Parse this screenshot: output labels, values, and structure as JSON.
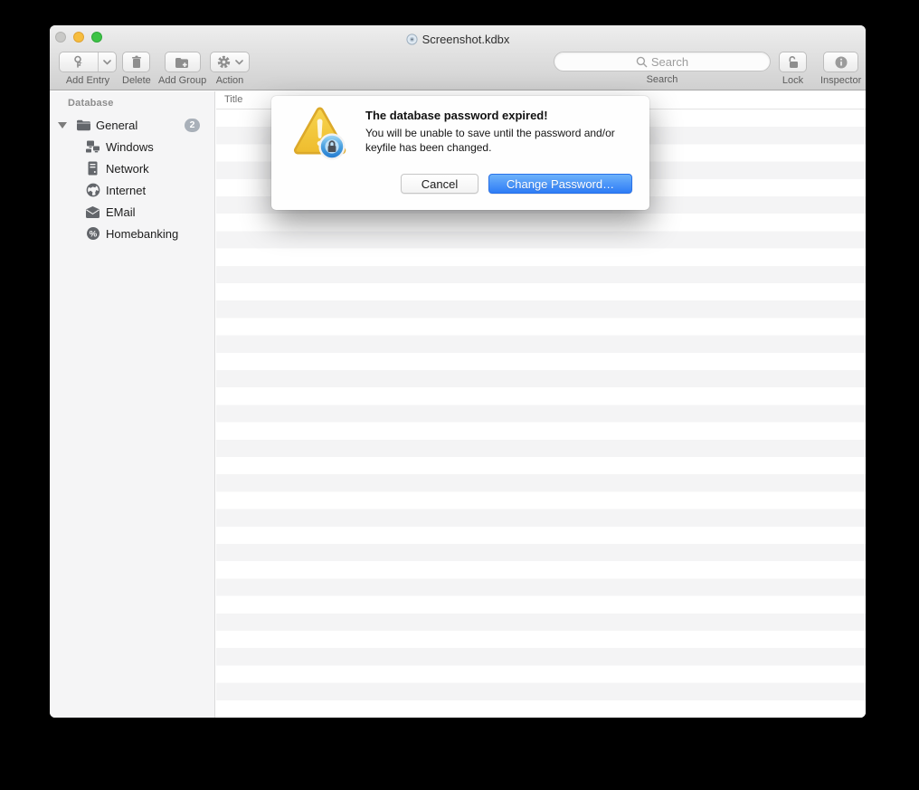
{
  "window": {
    "title": "Screenshot.kdbx"
  },
  "toolbar": {
    "add_entry_label": "Add Entry",
    "delete_label": "Delete",
    "add_group_label": "Add Group",
    "action_label": "Action",
    "search_placeholder": "Search",
    "search_label": "Search",
    "lock_label": "Lock",
    "inspector_label": "Inspector"
  },
  "sidebar": {
    "header": "Database",
    "items": [
      {
        "label": "General",
        "badge": "2",
        "icon": "folder-icon",
        "expanded": true
      },
      {
        "label": "Windows",
        "icon": "windows-network-icon"
      },
      {
        "label": "Network",
        "icon": "server-icon"
      },
      {
        "label": "Internet",
        "icon": "globe-icon"
      },
      {
        "label": "EMail",
        "icon": "envelope-icon"
      },
      {
        "label": "Homebanking",
        "icon": "percent-icon"
      }
    ]
  },
  "table": {
    "columns": [
      "Title"
    ],
    "rows": []
  },
  "dialog": {
    "title": "The database password expired!",
    "body": "You will be unable to save until the password and/or keyfile has been changed.",
    "cancel_label": "Cancel",
    "confirm_label": "Change Password…"
  },
  "colors": {
    "accent_blue": "#2e7cf6",
    "warning_yellow": "#f3c63f",
    "sidebar_bg": "#f5f5f6",
    "stripe_gray": "#f4f4f5",
    "badge_gray": "#a9b0b9",
    "traffic_close_gray": "#c9c9c7",
    "traffic_min_yellow": "#f6bd3e",
    "traffic_zoom_green": "#3dc345"
  }
}
